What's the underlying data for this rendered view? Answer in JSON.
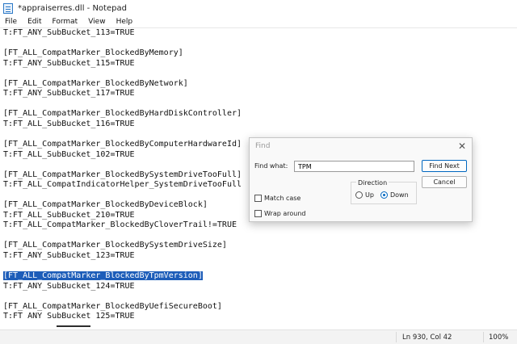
{
  "window": {
    "title": "*appraiserres.dll - Notepad",
    "icon": "notepad-icon"
  },
  "menu": [
    "File",
    "Edit",
    "Format",
    "View",
    "Help"
  ],
  "editor": {
    "lines": [
      "T:FT_ANY_SubBucket_113=TRUE",
      "",
      "[FT_ALL_CompatMarker_BlockedByMemory]",
      "T:FT_ANY_SubBucket_115=TRUE",
      "",
      "[FT_ALL_CompatMarker_BlockedByNetwork]",
      "T:FT_ANY_SubBucket_117=TRUE",
      "",
      "[FT_ALL_CompatMarker_BlockedByHardDiskController]",
      "T:FT_ALL_SubBucket_116=TRUE",
      "",
      "[FT_ALL_CompatMarker_BlockedByComputerHardwareId]",
      "T:FT_ALL_SubBucket_102=TRUE",
      "",
      "[FT_ALL_CompatMarker_BlockedBySystemDriveTooFull]",
      "T:FT_ALL_CompatIndicatorHelper_SystemDriveTooFull",
      "",
      "[FT_ALL_CompatMarker_BlockedByDeviceBlock]",
      "T:FT_ALL_SubBucket_210=TRUE",
      "T:FT_ALL_CompatMarker_BlockedByCloverTrail!=TRUE",
      "",
      "[FT_ALL_CompatMarker_BlockedBySystemDriveSize]",
      "T:FT_ANY_SubBucket_123=TRUE",
      "",
      "[FT_ALL_CompatMarker_BlockedByTpmVersion]",
      "T:FT_ANY_SubBucket_124=TRUE",
      "",
      "[FT_ALL_CompatMarker_BlockedByUefiSecureBoot]",
      "T:FT ANY SubBucket 125=TRUE"
    ],
    "highlighted_line_index": 24
  },
  "find_dialog": {
    "title": "Find",
    "find_what_label": "Find what:",
    "find_what_value": "TPM",
    "find_next_label": "Find Next",
    "cancel_label": "Cancel",
    "direction_label": "Direction",
    "up_label": "Up",
    "down_label": "Down",
    "direction_selected": "Down",
    "match_case_label": "Match case",
    "match_case_checked": false,
    "wrap_around_label": "Wrap around",
    "wrap_around_checked": false
  },
  "status": {
    "position": "Ln 930, Col 42",
    "zoom": "100%"
  },
  "colors": {
    "selection": "#1d5db9",
    "accent": "#0067c0"
  }
}
